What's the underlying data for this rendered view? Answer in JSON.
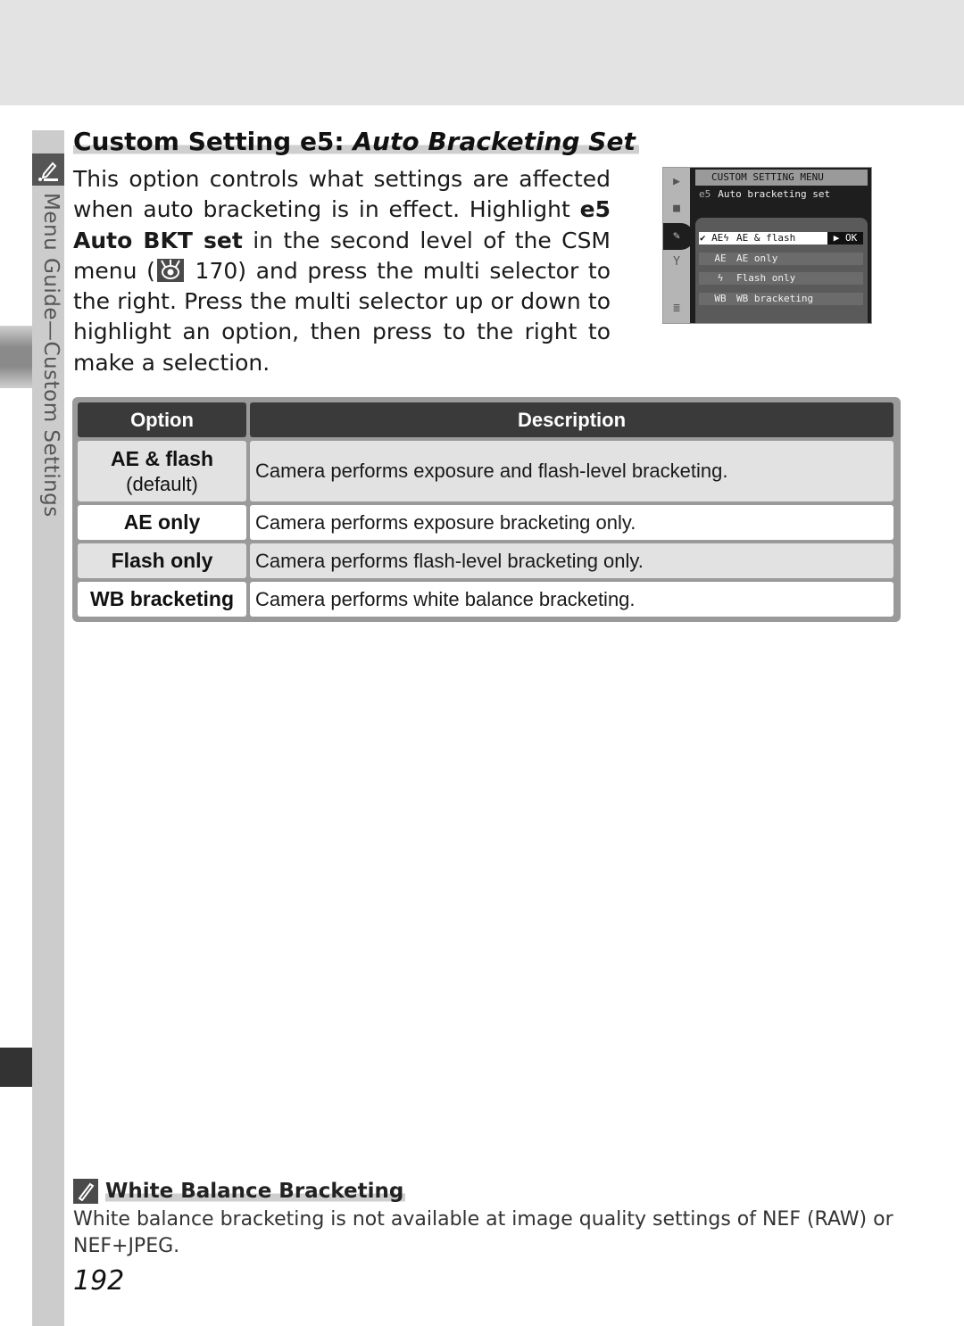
{
  "sidebar": {
    "section_label": "Menu Guide—Custom Settings",
    "icon": "pencil-icon"
  },
  "heading": {
    "prefix": "Custom Setting e5: ",
    "title_italic": "Auto Bracketing Set"
  },
  "intro": {
    "part1": "This option controls what settings are affected when auto bracketing is in effect.  Highlight ",
    "bold1": "e5 Auto BKT set",
    "part2": " in the second level of the CSM menu (",
    "ref_icon": "reference-page-icon",
    "ref_page": "170",
    "part3": ") and press the multi selector to the right.  Press the multi selector up or down to highlight an option, then press to the right to make a selection."
  },
  "camera_screen": {
    "header": "CUSTOM SETTING MENU",
    "code": "e5",
    "subtitle": "Auto bracketing set",
    "side_icons": [
      "playback-icon",
      "camera-icon",
      "pencil-icon",
      "wrench-icon",
      "recent-settings-icon"
    ],
    "options": [
      {
        "icon_text": "AEϟ",
        "label": "AE & flash",
        "selected": true,
        "checked": true,
        "action": "▶ OK"
      },
      {
        "icon_text": "AE",
        "label": "AE only",
        "selected": false
      },
      {
        "icon_text": "ϟ",
        "label": "Flash only",
        "selected": false
      },
      {
        "icon_text": "WB",
        "label": "WB bracketing",
        "selected": false
      }
    ]
  },
  "table": {
    "headers": [
      "Option",
      "Description"
    ],
    "rows": [
      {
        "option": "AE & flash",
        "note": "(default)",
        "description": "Camera performs exposure and flash-level bracketing."
      },
      {
        "option": "AE only",
        "note": "",
        "description": "Camera performs exposure bracketing only."
      },
      {
        "option": "Flash only",
        "note": "",
        "description": "Camera performs flash-level bracketing only."
      },
      {
        "option": "WB bracketing",
        "note": "",
        "description": "Camera performs white balance bracketing."
      }
    ]
  },
  "note": {
    "icon": "pencil-note-icon",
    "title": "White Balance Bracketing",
    "body": "White balance bracketing is not available at image quality settings of NEF (RAW) or NEF+JPEG."
  },
  "page_number": "192"
}
